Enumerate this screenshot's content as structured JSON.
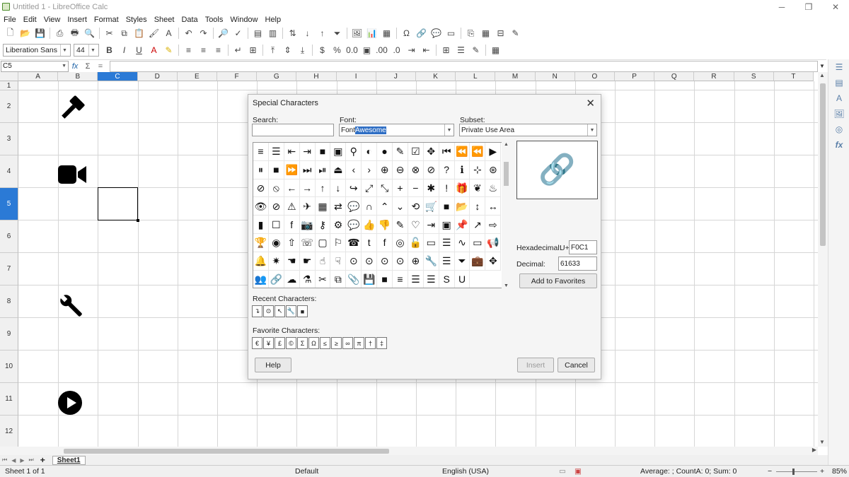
{
  "window": {
    "title": "Untitled 1 - LibreOffice Calc",
    "min": "─",
    "max": "❐",
    "close": "✕"
  },
  "menu": [
    "File",
    "Edit",
    "View",
    "Insert",
    "Format",
    "Styles",
    "Sheet",
    "Data",
    "Tools",
    "Window",
    "Help"
  ],
  "toolbar": {
    "font_name": "Liberation Sans",
    "font_size": "44"
  },
  "formula": {
    "cell_ref": "C5",
    "fx": "fx",
    "sigma": "Σ",
    "eq": "=",
    "value": ""
  },
  "columns": [
    "A",
    "B",
    "C",
    "D",
    "E",
    "F",
    "G",
    "H",
    "I",
    "J",
    "K",
    "L",
    "M",
    "N",
    "O",
    "P",
    "Q",
    "R",
    "S",
    "T"
  ],
  "selected_column": "C",
  "rows": [
    "1",
    "2",
    "3",
    "4",
    "5",
    "6",
    "7",
    "8",
    "9",
    "10",
    "11",
    "12"
  ],
  "selected_row": "5",
  "sheet_icons": [
    {
      "name": "gavel-icon",
      "glyph": "🔨"
    },
    {
      "name": "video-camera-icon",
      "glyph": "📹"
    },
    {
      "name": "wrench-icon",
      "glyph": "🔧"
    },
    {
      "name": "play-circle-icon",
      "glyph": "▶"
    }
  ],
  "dialog": {
    "title": "Special Characters",
    "search_label": "Search:",
    "search_value": "",
    "font_label": "Font:",
    "font_value_a": "Font",
    "font_value_b": "Awesome",
    "subset_label": "Subset:",
    "subset_value": "Private Use Area",
    "hex_label": "Hexadecimal:",
    "hex_prefix": "U+",
    "hex_value": "F0C1",
    "dec_label": "Decimal:",
    "dec_value": "61633",
    "preview_glyph": "🔗",
    "add_fav": "Add to Favorites",
    "recent_label": "Recent Characters:",
    "recent": [
      "↴",
      "⊙",
      "↖",
      "🔧",
      "■"
    ],
    "fav_label": "Favorite Characters:",
    "favorites": [
      "€",
      "¥",
      "£",
      "©",
      "Σ",
      "Ω",
      "≤",
      "≥",
      "∞",
      "π",
      "†",
      "‡"
    ],
    "help": "Help",
    "insert": "Insert",
    "cancel": "Cancel",
    "glyphs": [
      "≡",
      "☰",
      "⇤",
      "⇥",
      "■",
      "▣",
      "⚲",
      "◐",
      "●",
      "✎",
      "☑",
      "✥",
      "⏮",
      "⏪",
      "⏪",
      "▶",
      "⏸",
      "■",
      "⏩",
      "⏭",
      "⏯",
      "⏏",
      "‹",
      "›",
      "⊕",
      "⊖",
      "⊗",
      "⊘",
      "?",
      "ℹ",
      "⊹",
      "⊛",
      "⊘",
      "⦸",
      "←",
      "→",
      "↑",
      "↓",
      "↪",
      "⤢",
      "⤡",
      "+",
      "−",
      "✱",
      "!",
      "🎁",
      "❦",
      "♨",
      "👁",
      "⊘",
      "⚠",
      "✈",
      "▦",
      "⇄",
      "💬",
      "∩",
      "⌃",
      "⌄",
      "⟲",
      "🛒",
      "■",
      "📂",
      "↕",
      "↔",
      "▮",
      "☐",
      "f",
      "📷",
      "⚷",
      "⚙",
      "💬",
      "👍",
      "👎",
      "✎",
      "♡",
      "⇥",
      "▣",
      "📌",
      "↗",
      "⇨",
      "🏆",
      "◉",
      "⇧",
      "☏",
      "▢",
      "⚐",
      "☎",
      "t",
      "f",
      "◎",
      "🔓",
      "▭",
      "☰",
      "∿",
      "▭",
      "📢",
      "🔔",
      "✷",
      "☚",
      "☛",
      "☝",
      "☟",
      "⊙",
      "⊙",
      "⊙",
      "⊙",
      "⊕",
      "🔧",
      "☰",
      "⏷",
      "💼",
      "✥",
      "👥",
      "🔗",
      "☁",
      "⚗",
      "✂",
      "⧉",
      "📎",
      "💾",
      "■",
      "≡",
      "☰",
      "☰",
      "S",
      "U"
    ]
  },
  "sheettab": {
    "name": "Sheet1",
    "add": "+"
  },
  "status": {
    "sheet": "Sheet 1 of 1",
    "style": "Default",
    "lang": "English (USA)",
    "sum": "Average: ; CountA: 0; Sum: 0",
    "zoom": "85%",
    "zoom_minus": "−",
    "zoom_plus": "+"
  }
}
